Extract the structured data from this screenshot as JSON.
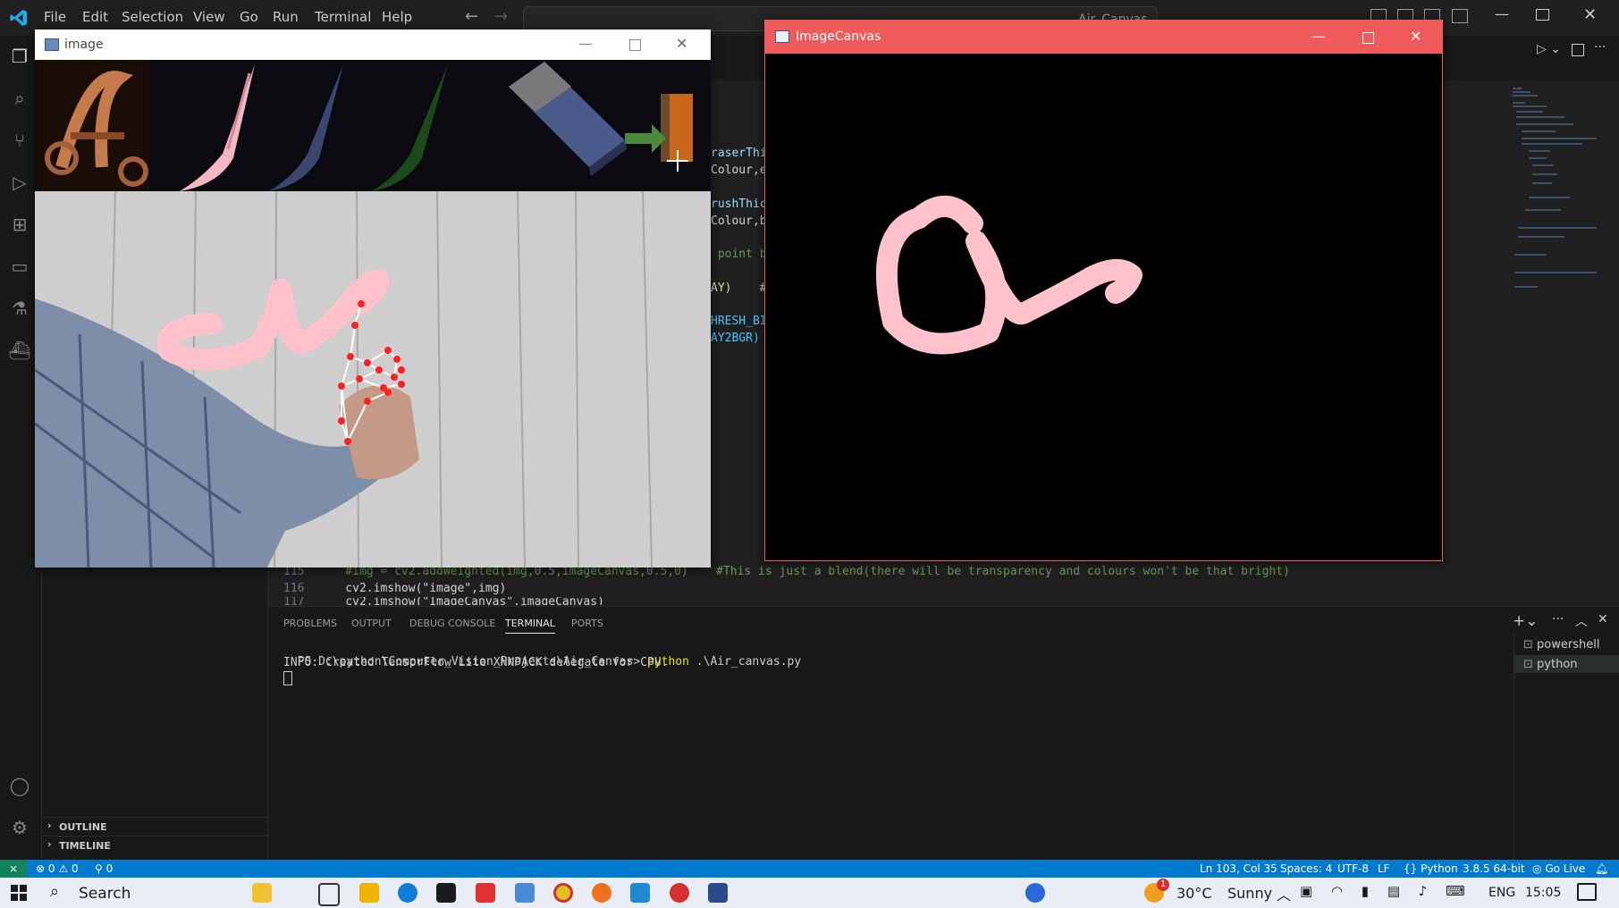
{
  "menu": [
    "File",
    "Edit",
    "Selection",
    "View",
    "Go",
    "Run",
    "Terminal",
    "Help"
  ],
  "search": {
    "text": "Air_Canvas"
  },
  "editor": {
    "fragments": [
      "raserThi",
      "Colour,e",
      "rushThic",
      "Colour,b",
      " point b",
      "AY)    #",
      "HRESH_BI",
      "AY2BGR)"
    ],
    "lines": [
      {
        "num": "115",
        "code": "    #img = cv2.addWeighted(img,0.5,imageCanvas,0.5,0)    #This is just a blend(there will be transparency and colours won't be that bright)"
      },
      {
        "num": "116",
        "code": "    cv2.imshow(\"image\",img)"
      },
      {
        "num": "117",
        "code": "    cv2.imshow(\"ImageCanvas\",imageCanvas)"
      }
    ]
  },
  "panel": {
    "tabs": [
      "PROBLEMS",
      "OUTPUT",
      "DEBUG CONSOLE",
      "TERMINAL",
      "PORTS"
    ],
    "active_tab": "TERMINAL",
    "terminal": {
      "prompt": "PS D:\\python\\Computer_Vision_Projects\\Air_Canvas>",
      "command": "python",
      "args": " .\\Air_canvas.py",
      "output": "INFO: Created TensorFlow Lite XNNPACK delegate for CPU."
    },
    "terminals": [
      "powershell",
      "python"
    ]
  },
  "sidebar": {
    "sections": [
      "OUTLINE",
      "TIMELINE"
    ]
  },
  "statusbar": {
    "errors": "0",
    "warnings": "0",
    "ports": "0",
    "position": "Ln 103, Col 35",
    "spaces": "Spaces: 4",
    "encoding": "UTF-8",
    "eol": "LF",
    "language": "Python",
    "interpreter": "3.8.5 64-bit",
    "golive": "Go Live"
  },
  "window_image": {
    "title": "image"
  },
  "window_canvas": {
    "title": "ImageCanvas"
  },
  "taskbar": {
    "search": "Search",
    "weather_temp": "30°C",
    "weather_desc": "Sunny",
    "lang": "ENG",
    "time": "15:05",
    "weather_badge": "1"
  },
  "colors": {
    "accent": "#007acc",
    "stroke": "#ffc1cc",
    "canvas_titlebar": "#f05a5a"
  }
}
